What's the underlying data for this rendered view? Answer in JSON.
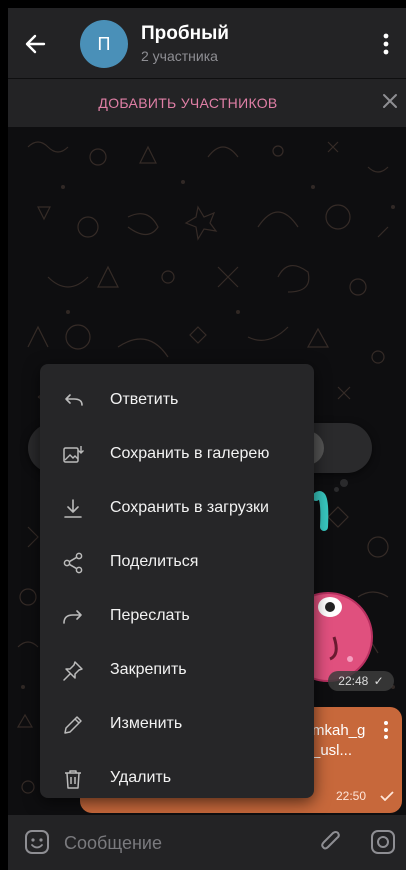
{
  "header": {
    "title": "Пробный",
    "subtitle": "2 участника",
    "avatar_letter": "П",
    "avatar_color": "#4a90b8"
  },
  "add_members": {
    "label": "ДОБАВИТЬ УЧАСТНИКОВ",
    "color": "#e07fa6"
  },
  "reactions": [
    "👍",
    "👎",
    "❤️",
    "🔥",
    "🥰",
    "👏",
    "😁"
  ],
  "messages": {
    "sticker_time": "22:48",
    "file_name": "mkah_g\n_usl...",
    "file_name_line1": "mkah_g",
    "file_name_line2": "_usl...",
    "file_time": "22:50",
    "file_bubble_color": "#c7683b"
  },
  "context_menu": {
    "items": [
      {
        "label": "Ответить",
        "icon": "reply-icon"
      },
      {
        "label": "Сохранить в галерею",
        "icon": "save-gallery-icon"
      },
      {
        "label": "Сохранить в загрузки",
        "icon": "download-icon"
      },
      {
        "label": "Поделиться",
        "icon": "share-icon"
      },
      {
        "label": "Переслать",
        "icon": "forward-icon"
      },
      {
        "label": "Закрепить",
        "icon": "pin-icon"
      },
      {
        "label": "Изменить",
        "icon": "edit-icon"
      },
      {
        "label": "Удалить",
        "icon": "delete-icon"
      }
    ]
  },
  "input": {
    "placeholder": "Сообщение"
  }
}
